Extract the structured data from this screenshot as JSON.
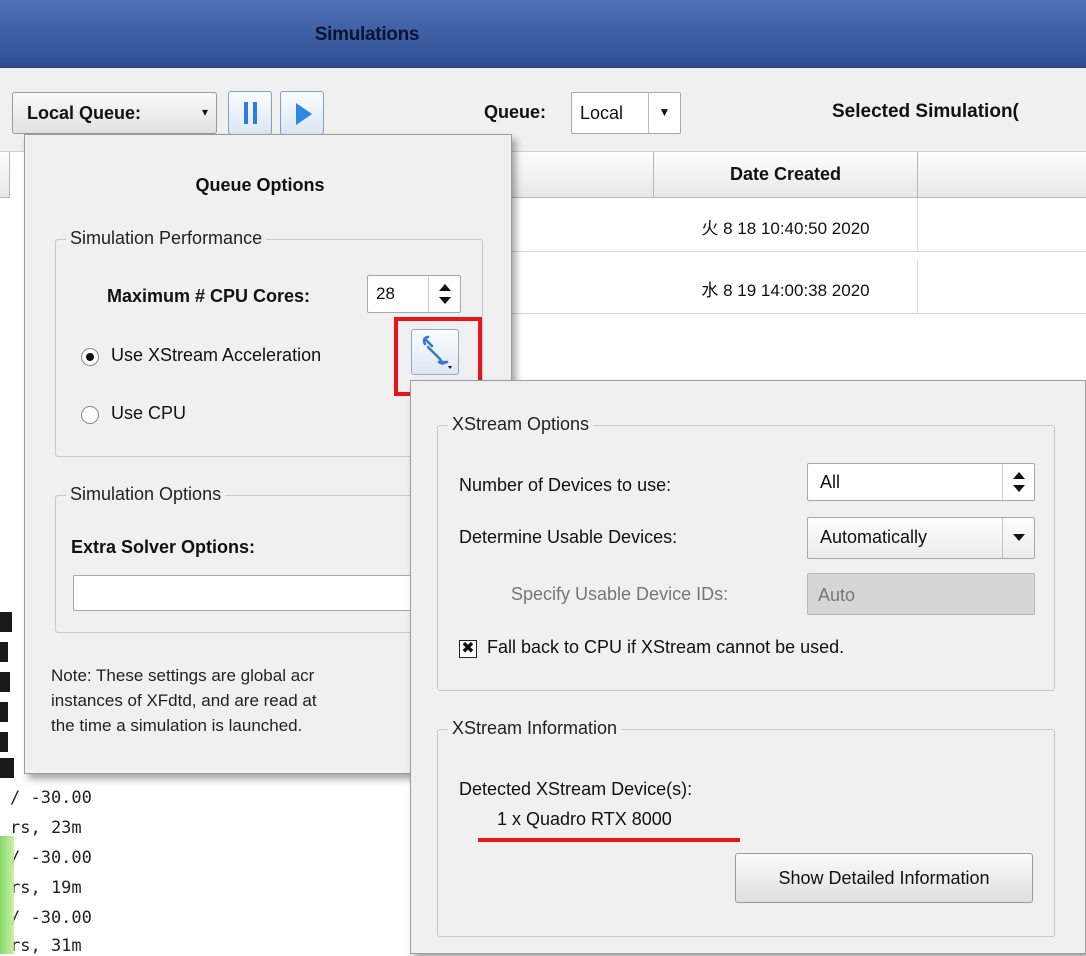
{
  "window": {
    "title": "Simulations"
  },
  "toolbar": {
    "local_queue_label": "Local Queue:",
    "queue_label": "Queue:",
    "queue_value": "Local",
    "selected_simulation_label": "Selected Simulation("
  },
  "table": {
    "headers": {
      "date_created": "Date Created"
    },
    "rows": [
      {
        "date_created": "火 8 18 10:40:50 2020"
      },
      {
        "date_created": "水 8 19 14:00:38 2020"
      }
    ]
  },
  "queue_options": {
    "title": "Queue Options",
    "performance": {
      "legend": "Simulation Performance",
      "max_cores_label": "Maximum # CPU Cores:",
      "max_cores_value": "28",
      "use_xstream_label": "Use XStream Acceleration",
      "use_cpu_label": "Use CPU",
      "selected": "xstream"
    },
    "options": {
      "legend": "Simulation Options",
      "extra_solver_label": "Extra Solver Options:",
      "extra_solver_value": ""
    },
    "note_lines": [
      "Note: These settings are global acr",
      "instances of XFdtd, and are read at",
      "the time a simulation is launched."
    ]
  },
  "xstream": {
    "options_legend": "XStream Options",
    "num_devices_label": "Number of Devices to use:",
    "num_devices_value": "All",
    "determine_label": "Determine Usable Devices:",
    "determine_value": "Automatically",
    "specify_ids_label": "Specify Usable Device IDs:",
    "specify_ids_value": "Auto",
    "fallback_label": "Fall back to CPU if XStream cannot be used.",
    "fallback_checked": true,
    "info_legend": "XStream Information",
    "detected_label": "Detected XStream Device(s):",
    "detected_device": "1 x Quadro RTX 8000",
    "show_details_label": "Show Detailed Information"
  },
  "console": {
    "lines": [
      "/ -30.00",
      "rs, 23m",
      "/ -30.00",
      "rs, 19m",
      "/ -30.00",
      "rs, 31m"
    ]
  },
  "colors": {
    "highlight_red": "#e8141b",
    "titlebar_blue": "#3d5ca5",
    "accent_blue": "#2d7be5"
  }
}
